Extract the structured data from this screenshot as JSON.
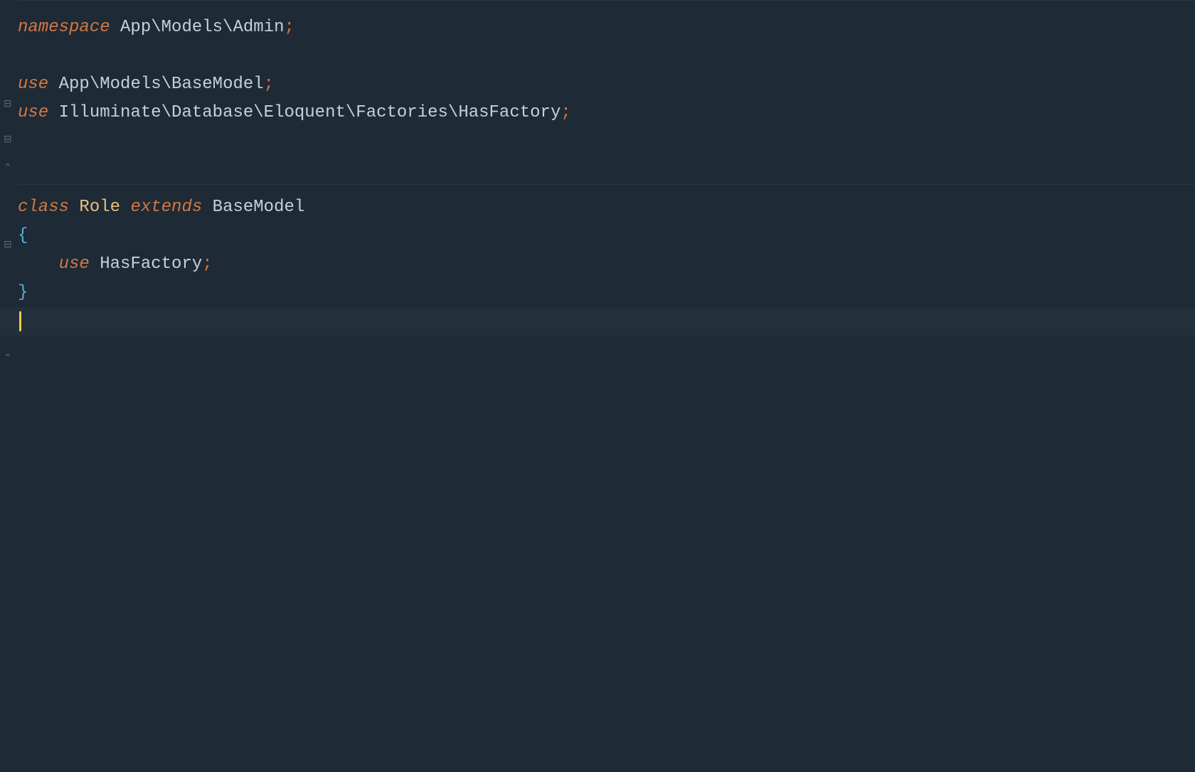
{
  "code": {
    "line1": {
      "kw_namespace": "namespace",
      "space1": " ",
      "path": "App\\Models\\Admin",
      "semi": ";"
    },
    "line2": {
      "kw_use": "use",
      "space1": " ",
      "path": "App\\Models\\BaseModel",
      "semi": ";"
    },
    "line3": {
      "kw_use": "use",
      "space1": " ",
      "path": "Illuminate\\Database\\Eloquent\\Factories\\HasFactory",
      "semi": ";"
    },
    "line4": {
      "kw_class": "class",
      "space1": " ",
      "classname": "Role",
      "space2": " ",
      "kw_extends": "extends",
      "space3": " ",
      "basetype": "BaseModel"
    },
    "line5": {
      "brace": "{"
    },
    "line6": {
      "indent": "    ",
      "kw_use": "use",
      "space1": " ",
      "trait": "HasFactory",
      "semi": ";"
    },
    "line7": {
      "brace": "}"
    }
  },
  "gutter": {
    "fold_collapsed": "▸",
    "fold_expanded": "▾",
    "fold_end": "▴"
  }
}
